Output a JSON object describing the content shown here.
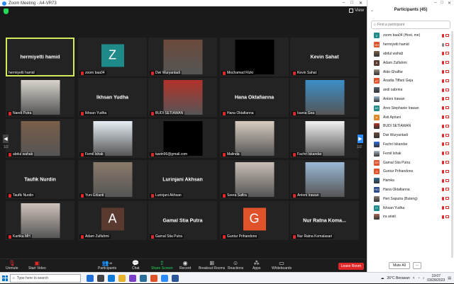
{
  "window": {
    "title": "Zoom Meeting - A4-VR73"
  },
  "topbar": {
    "view_label": "View"
  },
  "tiles": [
    {
      "name": "hermiyetti hamid",
      "label": "hermiyetti hamid",
      "type": "name",
      "active": true,
      "muted": false
    },
    {
      "name": "zoom baa04",
      "label": "zoom baa04",
      "type": "avatar",
      "initial": "Z",
      "color": "#1e8a8a",
      "muted": true
    },
    {
      "name": "Dwi Wuryantadi",
      "label": "Dwi Wuryantadi",
      "type": "photo",
      "color": "#6b4a3a",
      "muted": true
    },
    {
      "name": "Mochamad Rizki",
      "label": "Mochamad Rizki",
      "type": "black",
      "muted": true
    },
    {
      "name": "Kevin Sahat",
      "label": "Kevin Sahat",
      "type": "name",
      "muted": true
    },
    {
      "name": "Nandi Putra",
      "label": "Nandi Putra",
      "type": "photo",
      "color": "#d8d4cc",
      "muted": true
    },
    {
      "name": "Ikhsan Yudha",
      "label": "Ikhsan Yudha",
      "type": "name",
      "muted": true
    },
    {
      "name": "BUDI SETIAWAN",
      "label": "BUDI SETIAWAN",
      "type": "photo",
      "color": "#b3322a",
      "muted": true
    },
    {
      "name": "Hana Oktafianna",
      "label": "Hana Oktafianna",
      "type": "name",
      "muted": true
    },
    {
      "name": "Isania Gea",
      "label": "Isania Gea",
      "type": "photo",
      "color": "#3c8fc9",
      "muted": true
    },
    {
      "name": "abdul wahab",
      "label": "abdul wahab",
      "type": "photo",
      "color": "#7a5e48",
      "muted": true
    },
    {
      "name": "Femil Ishak",
      "label": "Femil Ishak",
      "type": "photo",
      "color": "#e6eef5",
      "muted": true
    },
    {
      "name": "tuwin96@gmail.com",
      "label": "tuwin96@gmail.com",
      "type": "black",
      "muted": true
    },
    {
      "name": "Malinda",
      "label": "Malinda",
      "type": "photo",
      "color": "#d9cdc0",
      "muted": true
    },
    {
      "name": "Fachri Iskandar",
      "label": "Fachri Iskandar",
      "type": "photo",
      "color": "#f2f2f2",
      "muted": true
    },
    {
      "name": "Taufik Nurdin",
      "label": "Taufik Nurdin",
      "type": "name",
      "muted": true
    },
    {
      "name": "Yuni Erlianti",
      "label": "Yuni Erlianti",
      "type": "photo",
      "color": "#8a7a6a",
      "muted": true
    },
    {
      "name": "Lurinjani Akhsan",
      "label": "Lurinjani Akhsan",
      "type": "name",
      "muted": true
    },
    {
      "name": "Seera Safira",
      "label": "Seera Safira",
      "type": "photo",
      "color": "#c9bfb5",
      "muted": true
    },
    {
      "name": "Antoni Irawan",
      "label": "Antoni Irawan",
      "type": "photo",
      "color": "#9cb9d6",
      "muted": true
    },
    {
      "name": "Kartika MH",
      "label": "Kartika MH",
      "type": "photo",
      "color": "#cfc3bb",
      "muted": true
    },
    {
      "name": "Adam Zulfahmi",
      "label": "Adam Zulfahmi",
      "type": "avatar",
      "initial": "A",
      "color": "#5a3a2e",
      "muted": true
    },
    {
      "name": "Gamal Stia Putra",
      "label": "Gamal Stia Putra",
      "type": "name",
      "muted": true
    },
    {
      "name": "Guntur Prihandono",
      "label": "Guntur Prihandono",
      "type": "avatar",
      "initial": "G",
      "color": "#e0522a",
      "muted": true
    },
    {
      "name": "Nur Ratna Koma...",
      "label": "Nur Ratna Komalasari",
      "type": "name",
      "muted": true
    }
  ],
  "pagination": {
    "left": "1/2",
    "right": "1/2"
  },
  "toolbar": {
    "unmute": "Unmute",
    "video": "Start Video",
    "participants": "Participants",
    "participants_count": "45",
    "chat": "Chat",
    "share": "Share Screen",
    "record": "Record",
    "breakout": "Breakout Rooms",
    "reactions": "Reactions",
    "apps": "Apps",
    "whiteboards": "Whiteboards",
    "leave": "Leave Room"
  },
  "panel": {
    "title": "Participants (45)",
    "search_placeholder": "Find a participant",
    "mute_all": "Mute All",
    "more": "...",
    "participants": [
      {
        "name": "zoom baa04 (Host, me)",
        "initial": "Z",
        "color": "#1e8a8a",
        "photo": false
      },
      {
        "name": "hermiyetti hamid",
        "initial": "HH",
        "color": "#e0522a",
        "photo": false,
        "unmuted": true
      },
      {
        "name": "abdul wahab",
        "initial": "",
        "color": "#7a5e48",
        "photo": true
      },
      {
        "name": "Adam Zulfahmi",
        "initial": "A",
        "color": "#5a3a2e",
        "photo": false
      },
      {
        "name": "Aldo Ghaffar",
        "initial": "",
        "color": "#9b8e80",
        "photo": true
      },
      {
        "name": "Anadia Tiffani Geja",
        "initial": "AT",
        "color": "#e0522a",
        "photo": false
      },
      {
        "name": "andi sabrina",
        "initial": "",
        "color": "#556677",
        "photo": true
      },
      {
        "name": "Antoni Irawan",
        "initial": "",
        "color": "#9cb9d6",
        "photo": true
      },
      {
        "name": "Ares Stephanie Irawan",
        "initial": "AS",
        "color": "#1e8a8a",
        "photo": false
      },
      {
        "name": "Asti Apriani",
        "initial": "A",
        "color": "#e08a2a",
        "photo": false
      },
      {
        "name": "BUDI SETIAWAN",
        "initial": "",
        "color": "#b3322a",
        "photo": true
      },
      {
        "name": "Dwi Wuryantadi",
        "initial": "",
        "color": "#6b4a3a",
        "photo": true
      },
      {
        "name": "Fachri Iskandar",
        "initial": "",
        "color": "#2d6cdf",
        "photo": true
      },
      {
        "name": "Femil Ishak",
        "initial": "",
        "color": "#a8b8c8",
        "photo": true
      },
      {
        "name": "Gamal Stia Putra",
        "initial": "GS",
        "color": "#e0522a",
        "photo": false
      },
      {
        "name": "Guntur Prihandono",
        "initial": "G",
        "color": "#e0522a",
        "photo": false
      },
      {
        "name": "Hamka",
        "initial": "",
        "color": "#2a6e9a",
        "photo": true
      },
      {
        "name": "Hana Oktafianna",
        "initial": "HO",
        "color": "#2a4a8a",
        "photo": false
      },
      {
        "name": "Heri Saputra (Buteng)",
        "initial": "",
        "color": "#8a7a6a",
        "photo": true
      },
      {
        "name": "Ikhsan Yudha",
        "initial": "IY",
        "color": "#1e8a8a",
        "photo": false
      },
      {
        "name": "ira ariati",
        "initial": "",
        "color": "#aa6655",
        "photo": true
      }
    ]
  },
  "taskbar": {
    "search_placeholder": "Type here to search",
    "weather": "26°C Berawan",
    "time": "19:07",
    "date": "03/28/2023"
  }
}
